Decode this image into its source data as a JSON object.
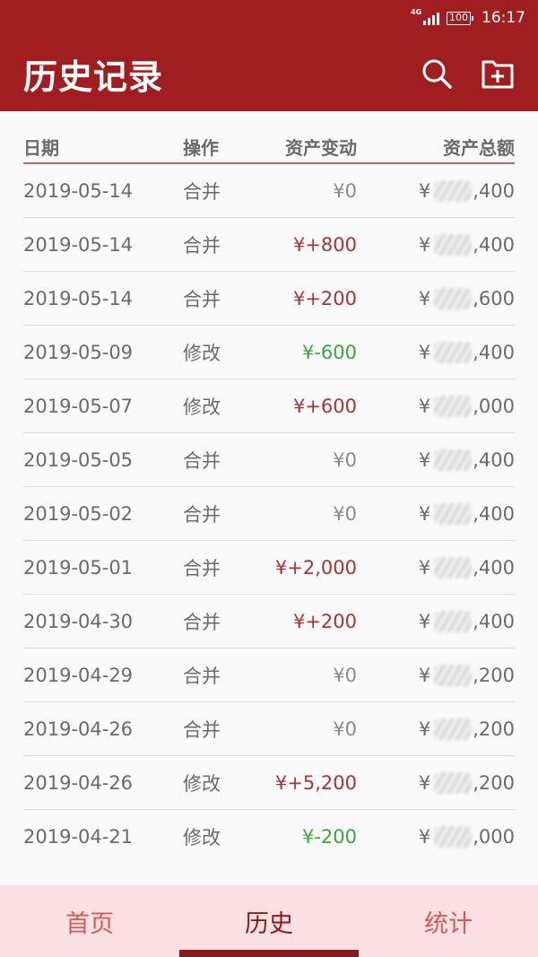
{
  "status_bar": {
    "network": "4G",
    "battery": "100",
    "time": "16:17"
  },
  "app_bar": {
    "title": "历史记录",
    "icons": [
      "search-icon",
      "add-file-icon"
    ]
  },
  "table": {
    "headers": {
      "date": "日期",
      "operation": "操作",
      "change": "资产变动",
      "total": "资产总额"
    },
    "currency": "¥",
    "rows": [
      {
        "date": "2019-05-14",
        "operation": "合并",
        "change": "¥0",
        "change_type": "zero",
        "total_suffix": ",400"
      },
      {
        "date": "2019-05-14",
        "operation": "合并",
        "change": "¥+800",
        "change_type": "pos",
        "total_suffix": ",400"
      },
      {
        "date": "2019-05-14",
        "operation": "合并",
        "change": "¥+200",
        "change_type": "pos",
        "total_suffix": ",600"
      },
      {
        "date": "2019-05-09",
        "operation": "修改",
        "change": "¥-600",
        "change_type": "neg",
        "total_suffix": ",400"
      },
      {
        "date": "2019-05-07",
        "operation": "修改",
        "change": "¥+600",
        "change_type": "pos",
        "total_suffix": ",000"
      },
      {
        "date": "2019-05-05",
        "operation": "合并",
        "change": "¥0",
        "change_type": "zero",
        "total_suffix": ",400"
      },
      {
        "date": "2019-05-02",
        "operation": "合并",
        "change": "¥0",
        "change_type": "zero",
        "total_suffix": ",400"
      },
      {
        "date": "2019-05-01",
        "operation": "合并",
        "change": "¥+2,000",
        "change_type": "pos",
        "total_suffix": ",400"
      },
      {
        "date": "2019-04-30",
        "operation": "合并",
        "change": "¥+200",
        "change_type": "pos",
        "total_suffix": ",400"
      },
      {
        "date": "2019-04-29",
        "operation": "合并",
        "change": "¥0",
        "change_type": "zero",
        "total_suffix": ",200"
      },
      {
        "date": "2019-04-26",
        "operation": "合并",
        "change": "¥0",
        "change_type": "zero",
        "total_suffix": ",200"
      },
      {
        "date": "2019-04-26",
        "operation": "修改",
        "change": "¥+5,200",
        "change_type": "pos",
        "total_suffix": ",200"
      },
      {
        "date": "2019-04-21",
        "operation": "修改",
        "change": "¥-200",
        "change_type": "neg",
        "total_suffix": ",000"
      }
    ]
  },
  "bottom_nav": {
    "items": [
      {
        "label": "首页",
        "active": false
      },
      {
        "label": "历史",
        "active": true
      },
      {
        "label": "统计",
        "active": false
      }
    ]
  },
  "colors": {
    "brand": "#a01e20",
    "positive": "#a93232",
    "negative": "#3aa63a",
    "nav_background": "#fbe1e1"
  }
}
